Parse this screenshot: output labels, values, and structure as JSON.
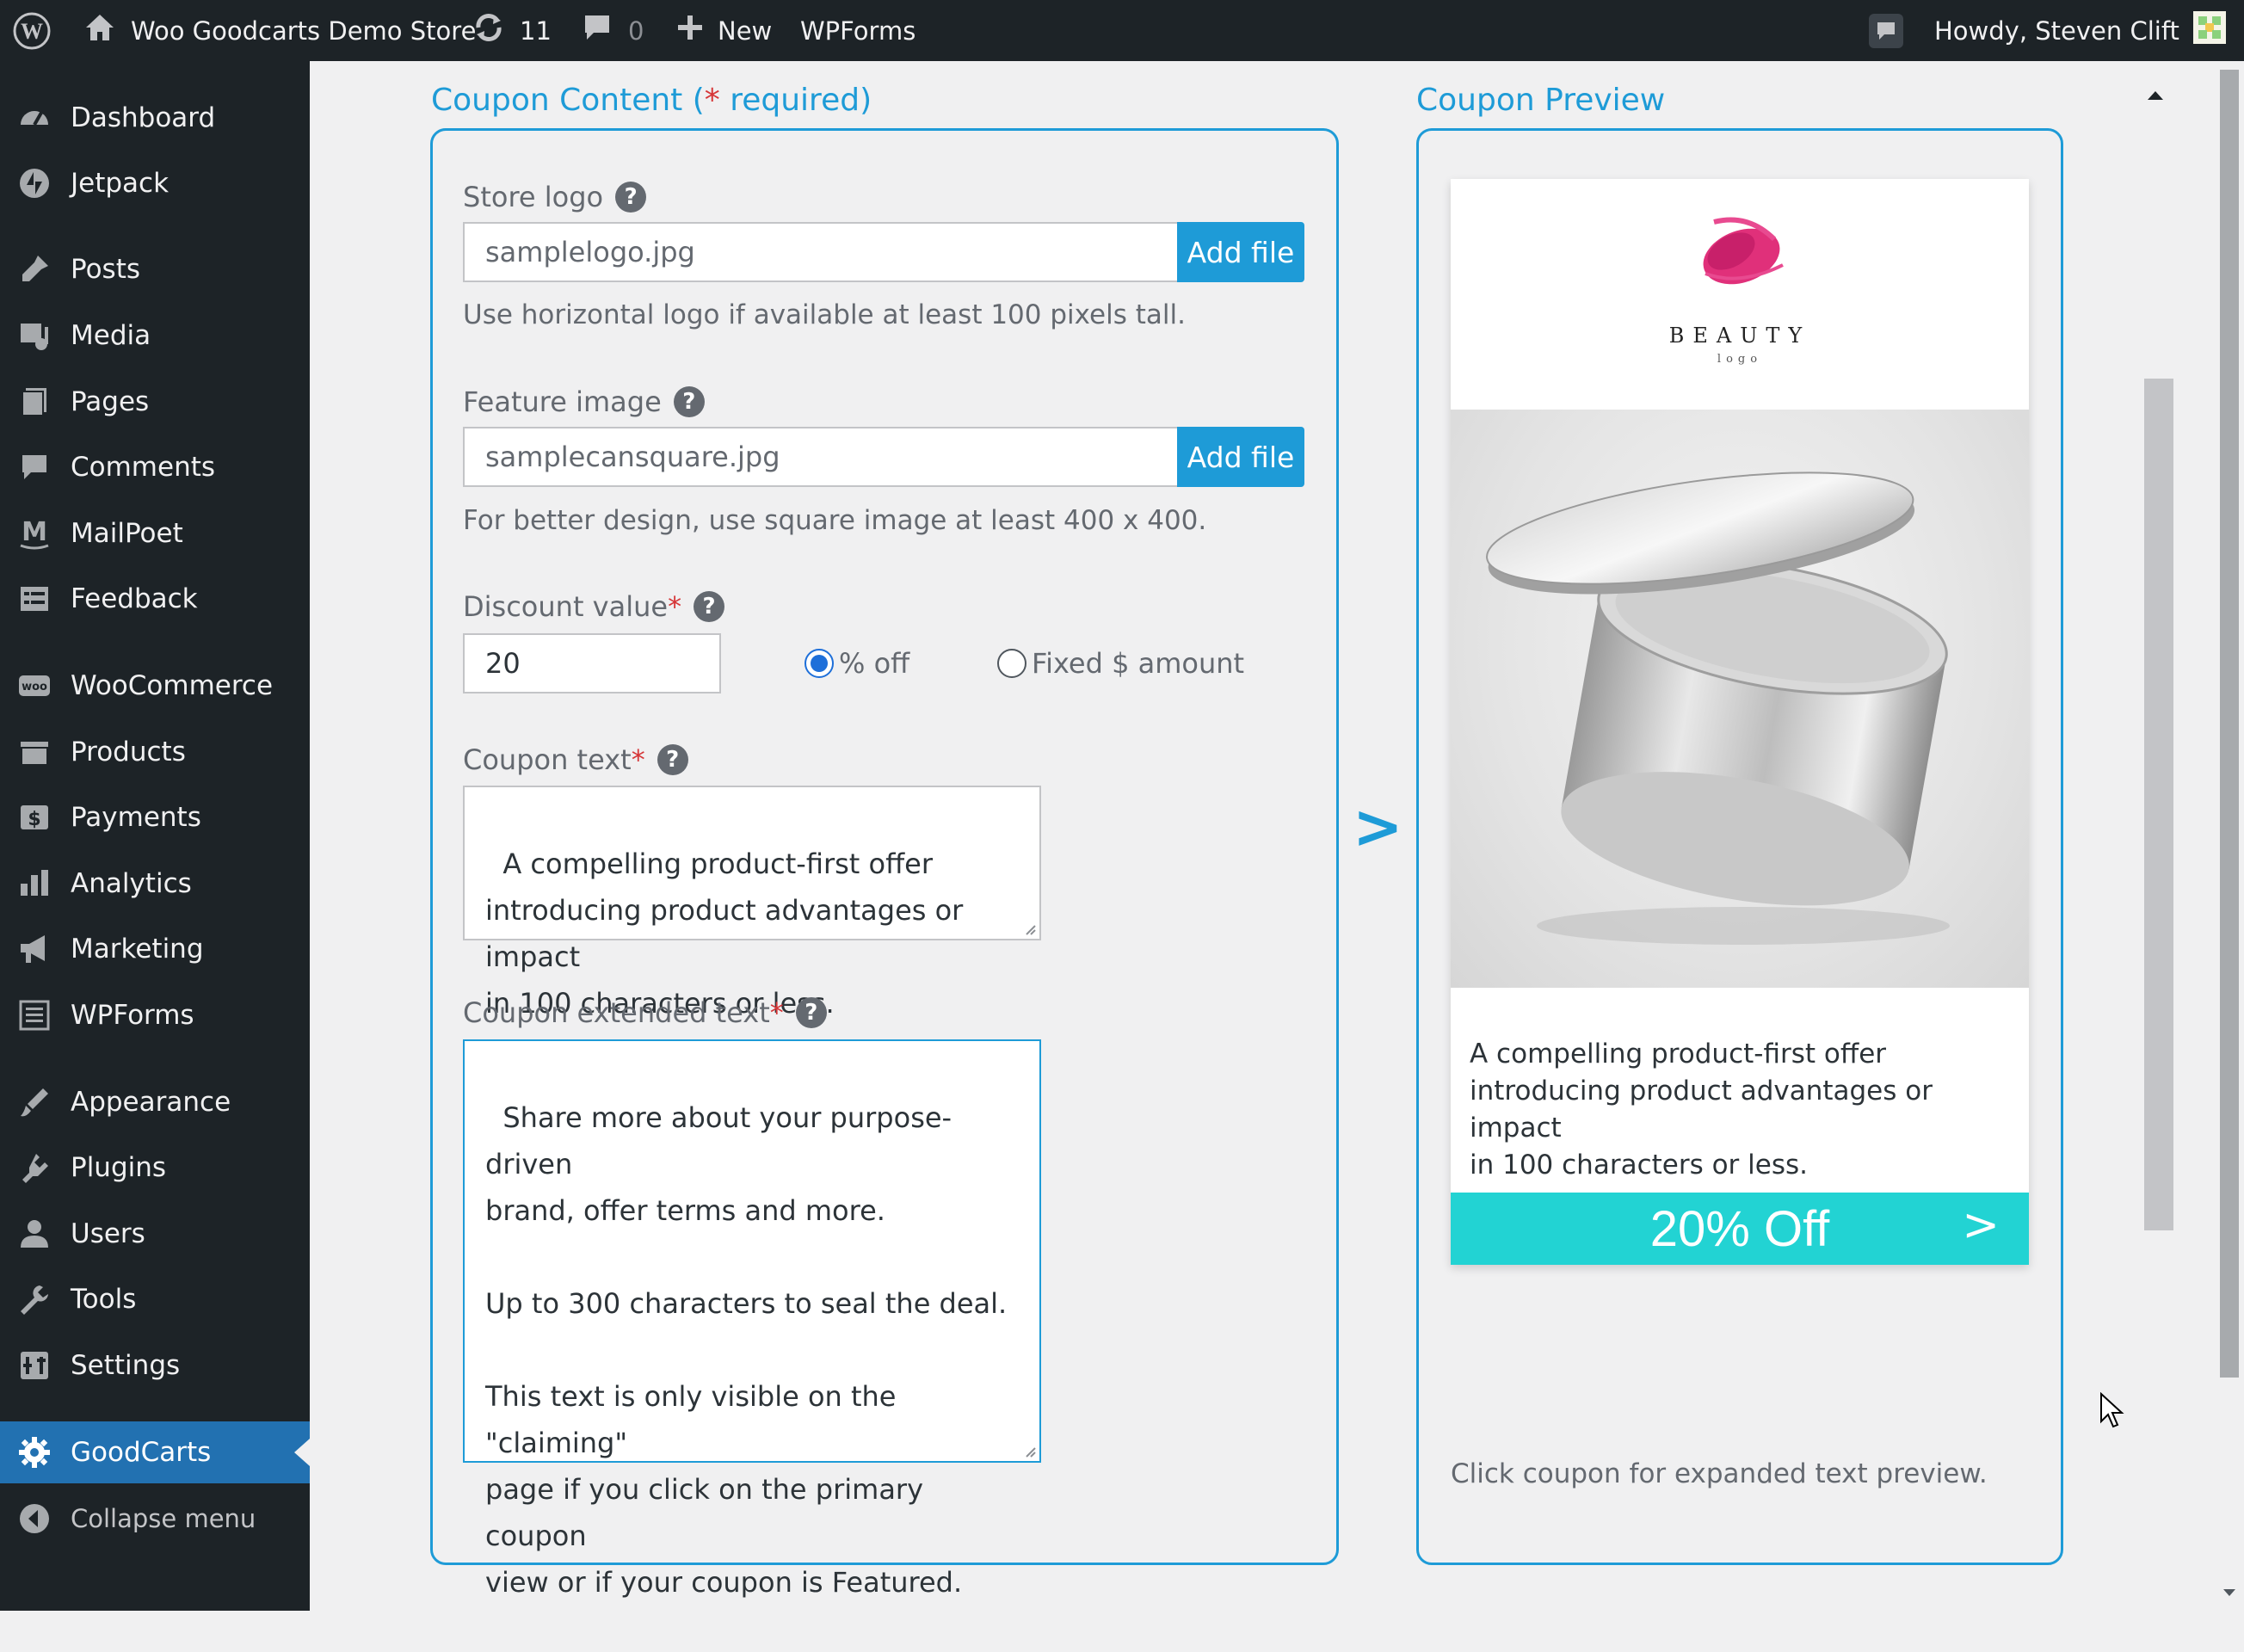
{
  "admin_bar": {
    "site_name": "Woo Goodcarts Demo Store",
    "updates_count": "11",
    "comments_count": "0",
    "new_label": "New",
    "wpforms_label": "WPForms",
    "howdy": "Howdy, Steven Clift"
  },
  "sidebar": {
    "items": [
      {
        "label": "Dashboard",
        "icon": "dashboard-icon"
      },
      {
        "label": "Jetpack",
        "icon": "jetpack-icon"
      },
      {
        "label": "Posts",
        "icon": "posts-icon"
      },
      {
        "label": "Media",
        "icon": "media-icon"
      },
      {
        "label": "Pages",
        "icon": "pages-icon"
      },
      {
        "label": "Comments",
        "icon": "comments-icon"
      },
      {
        "label": "MailPoet",
        "icon": "mailpoet-icon"
      },
      {
        "label": "Feedback",
        "icon": "feedback-icon"
      },
      {
        "label": "WooCommerce",
        "icon": "woocommerce-icon"
      },
      {
        "label": "Products",
        "icon": "products-icon"
      },
      {
        "label": "Payments",
        "icon": "payments-icon"
      },
      {
        "label": "Analytics",
        "icon": "analytics-icon"
      },
      {
        "label": "Marketing",
        "icon": "marketing-icon"
      },
      {
        "label": "WPForms",
        "icon": "wpforms-icon"
      },
      {
        "label": "Appearance",
        "icon": "appearance-icon"
      },
      {
        "label": "Plugins",
        "icon": "plugins-icon"
      },
      {
        "label": "Users",
        "icon": "users-icon"
      },
      {
        "label": "Tools",
        "icon": "tools-icon"
      },
      {
        "label": "Settings",
        "icon": "settings-icon"
      },
      {
        "label": "GoodCarts",
        "icon": "gear-icon",
        "current": true
      },
      {
        "label": "Collapse menu",
        "icon": "collapse-icon"
      }
    ]
  },
  "content": {
    "title": "Coupon Content (",
    "title_star": "*",
    "title_required": " required)",
    "store_logo": {
      "label": "Store logo",
      "value": "samplelogo.jpg",
      "button": "Add file",
      "hint": "Use horizontal logo if available at least 100 pixels tall."
    },
    "feature_image": {
      "label": "Feature image",
      "value": "samplecansquare.jpg",
      "button": "Add file",
      "hint": "For better design, use square image at least 400 x 400."
    },
    "discount": {
      "label": "Discount value",
      "star": "*",
      "value": "20",
      "options": [
        "% off",
        "Fixed $ amount"
      ],
      "selected": "% off"
    },
    "coupon_text": {
      "label": "Coupon text",
      "star": "*",
      "value": "A compelling product-first offer\nintroducing product advantages or impact\nin 100 characters or less."
    },
    "extended_text": {
      "label": "Coupon extended text",
      "star": "*",
      "value": "Share more about your purpose-driven\nbrand, offer terms and more.\n\nUp to 300 characters to seal the deal.\n\nThis text is only visible on the \"claiming\"\npage if you click on the primary coupon\nview or if your coupon is Featured."
    },
    "help_glyph": "?"
  },
  "arrow_glyph": ">",
  "preview": {
    "title": "Coupon Preview",
    "logo_word": "BEAUTY",
    "logo_sub": "logo",
    "body_text": "A compelling product-first offer\nintroducing product advantages or impact\nin 100 characters or less.",
    "cta_label": "20% Off",
    "cta_arrow": ">",
    "footer_hint": "Click coupon for expanded text preview."
  },
  "colors": {
    "accent": "#1e9bd7",
    "cta": "#22d3d3",
    "sidebar": "#1d2327",
    "current": "#2271b1",
    "required": "#d63638"
  }
}
